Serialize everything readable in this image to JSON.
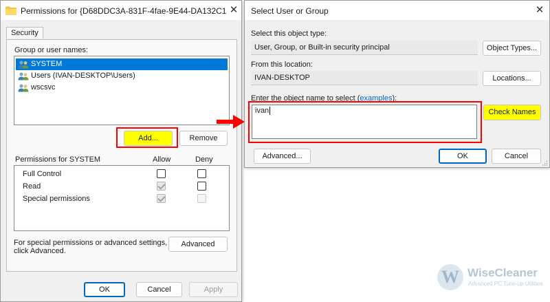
{
  "perm_dialog": {
    "title": "Permissions for {D68DDC3A-831F-4fae-9E44-DA132C1...",
    "tab": "Security",
    "group_label": "Group or user names:",
    "users": [
      {
        "name": "SYSTEM",
        "selected": true
      },
      {
        "name": "Users (IVAN-DESKTOP\\Users)",
        "selected": false
      },
      {
        "name": "wscsvc",
        "selected": false
      }
    ],
    "add_label": "Add...",
    "remove_label": "Remove",
    "perms_header": "Permissions for SYSTEM",
    "allow_header": "Allow",
    "deny_header": "Deny",
    "permissions": [
      {
        "name": "Full Control",
        "allow": "unchecked",
        "deny": "unchecked"
      },
      {
        "name": "Read",
        "allow": "checked-disabled",
        "deny": "unchecked"
      },
      {
        "name": "Special permissions",
        "allow": "checked-disabled",
        "deny": "disabled"
      }
    ],
    "special_text_line1": "For special permissions or advanced settings,",
    "special_text_line2": "click Advanced.",
    "advanced_label": "Advanced",
    "ok_label": "OK",
    "cancel_label": "Cancel",
    "apply_label": "Apply"
  },
  "select_dialog": {
    "title": "Select User or Group",
    "object_type_label": "Select this object type:",
    "object_type_value": "User, Group, or Built-in security principal",
    "object_types_button": "Object Types...",
    "location_label": "From this location:",
    "location_value": "IVAN-DESKTOP",
    "locations_button": "Locations...",
    "enter_label_pre": "Enter the object name to select (",
    "enter_label_link": "examples",
    "enter_label_post": "):",
    "name_input_value": "ivan",
    "check_names_button": "Check Names",
    "advanced_button": "Advanced...",
    "ok_label": "OK",
    "cancel_label": "Cancel"
  },
  "watermark": {
    "logo_letter": "W",
    "brand": "WiseCleaner",
    "tagline": "Advanced PC Tune-up Utilities"
  },
  "colors": {
    "highlight": "#ffff00",
    "annotation_red": "#ff0000",
    "selection_blue": "#0078d7",
    "primary_border": "#0067c0"
  }
}
